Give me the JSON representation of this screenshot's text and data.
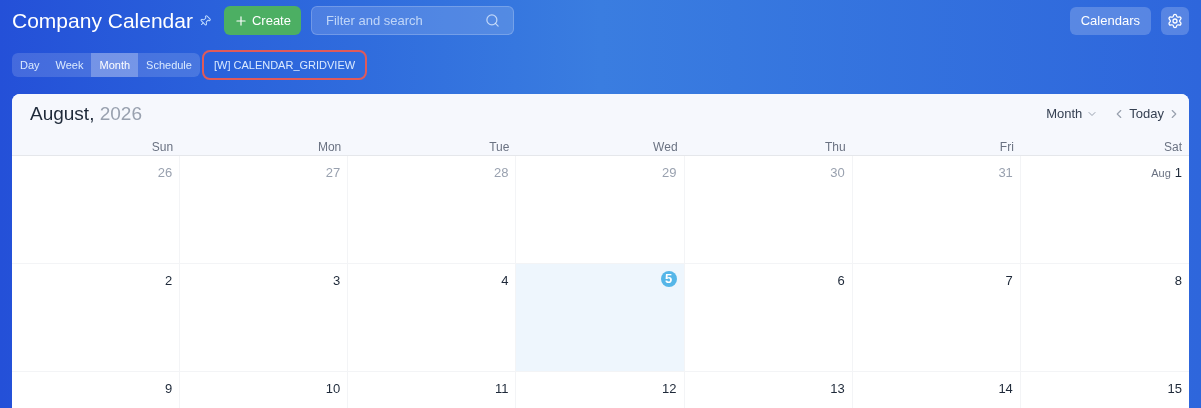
{
  "header": {
    "title": "Company Calendar",
    "create_button": "Create",
    "search": {
      "placeholder": "Filter and search"
    },
    "calendars_button": "Calendars"
  },
  "view_tabs": [
    {
      "label": "Day",
      "selected": false
    },
    {
      "label": "Week",
      "selected": false
    },
    {
      "label": "Month",
      "selected": true
    },
    {
      "label": "Schedule",
      "selected": false
    }
  ],
  "view_tag": {
    "label": "[W] CALENDAR_GRIDVIEW",
    "highlighted": true
  },
  "calendar": {
    "month": "August,",
    "year": "2026",
    "view_select": "Month",
    "today_button": "Today",
    "weekdays": [
      "Sun",
      "Mon",
      "Tue",
      "Wed",
      "Thu",
      "Fri",
      "Sat"
    ],
    "weeks": [
      {
        "days": [
          {
            "day": "26",
            "muted": true,
            "today": false
          },
          {
            "day": "27",
            "muted": true,
            "today": false
          },
          {
            "day": "28",
            "muted": true,
            "today": false
          },
          {
            "day": "29",
            "muted": true,
            "today": false
          },
          {
            "day": "30",
            "muted": true,
            "today": false
          },
          {
            "day": "31",
            "muted": true,
            "today": false
          },
          {
            "day": "1",
            "month_label": "Aug",
            "muted": false,
            "today": false
          }
        ]
      },
      {
        "days": [
          {
            "day": "2",
            "muted": false,
            "today": false
          },
          {
            "day": "3",
            "muted": false,
            "today": false
          },
          {
            "day": "4",
            "muted": false,
            "today": false
          },
          {
            "day": "5",
            "muted": false,
            "today": true
          },
          {
            "day": "6",
            "muted": false,
            "today": false
          },
          {
            "day": "7",
            "muted": false,
            "today": false
          },
          {
            "day": "8",
            "muted": false,
            "today": false
          }
        ]
      },
      {
        "days": [
          {
            "day": "9",
            "muted": false,
            "today": false
          },
          {
            "day": "10",
            "muted": false,
            "today": false
          },
          {
            "day": "11",
            "muted": false,
            "today": false
          },
          {
            "day": "12",
            "muted": false,
            "today": false
          },
          {
            "day": "13",
            "muted": false,
            "today": false
          },
          {
            "day": "14",
            "muted": false,
            "today": false
          },
          {
            "day": "15",
            "muted": false,
            "today": false
          }
        ]
      }
    ]
  }
}
